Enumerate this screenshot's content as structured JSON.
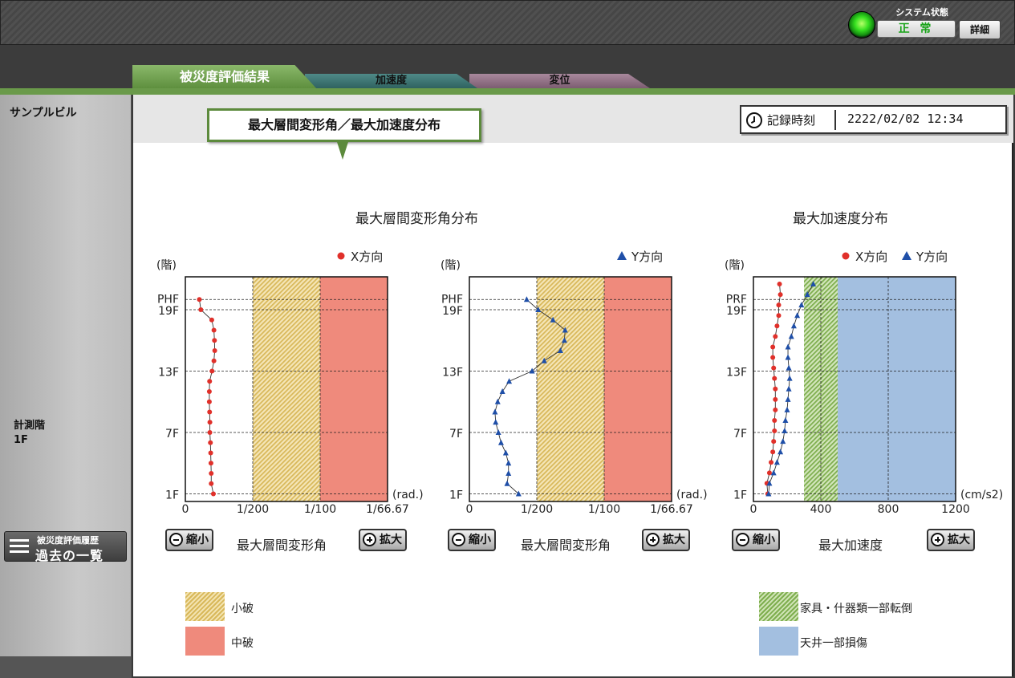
{
  "header": {
    "system_status_label": "システム状態",
    "system_status_value": "正 常",
    "status_led_color": "#36e020",
    "detail_button": "詳細"
  },
  "tabs": [
    {
      "label": "被災度評価結果",
      "active": true,
      "color": "#6a9a4a"
    },
    {
      "label": "加速度",
      "active": false,
      "color": "#3f7876"
    },
    {
      "label": "変位",
      "active": false,
      "color": "#8f7084"
    }
  ],
  "sidebar": {
    "building_name": "サンプルビル",
    "measurement_floor_label": "計測階",
    "measurement_floor_value": "1F",
    "history_button_sub": "被災度評価履歴",
    "history_button_main": "過去の一覧"
  },
  "main": {
    "section_title": "最大層間変形角／最大加速度分布",
    "record_time_label": "記録時刻",
    "record_time_value": "2222/02/02 12:34",
    "drift_title": "最大層間変形角分布",
    "accel_title": "最大加速度分布",
    "zoom_out_label": "縮小",
    "zoom_in_label": "拡大",
    "drift_axis_caption": "最大層間変形角",
    "accel_axis_caption": "最大加速度",
    "legend": [
      {
        "label": "小破",
        "style": "hatch-yellow"
      },
      {
        "label": "中破",
        "style": "fill-red"
      },
      {
        "label": "家具・什器類一部転倒",
        "style": "hatch-green"
      },
      {
        "label": "天井一部損傷",
        "style": "fill-blue"
      }
    ]
  },
  "chart_data": [
    {
      "type": "line",
      "title": "最大層間変形角分布",
      "xlabel": "最大層間変形角",
      "ylabel": "(階)",
      "x_unit": "(rad.)",
      "x_ticks": [
        "0",
        "1/200",
        "1/100",
        "1/66.67"
      ],
      "xlim": [
        0,
        0.015
      ],
      "y_ticks": [
        "1F",
        "7F",
        "13F",
        "19F",
        "PHF"
      ],
      "ylim": [
        0.5,
        21.5
      ],
      "legend": "top-right",
      "zones": [
        {
          "label": "小破",
          "from": 0.005,
          "to": 0.01,
          "color": "#d8b85a"
        },
        {
          "label": "中破",
          "from": 0.01,
          "to": 0.015,
          "color": "#ef8a7c"
        }
      ],
      "series": [
        {
          "name": "X方向",
          "color": "#e0302a",
          "marker": "circle",
          "floors": [
            1,
            2,
            3,
            4,
            5,
            6,
            7,
            8,
            9,
            10,
            11,
            12,
            13,
            14,
            15,
            16,
            17,
            18,
            19,
            20
          ],
          "values": [
            0.00208,
            0.00192,
            0.00192,
            0.0019,
            0.00188,
            0.00186,
            0.00182,
            0.00182,
            0.0018,
            0.00178,
            0.00178,
            0.0018,
            0.00198,
            0.00212,
            0.00218,
            0.00216,
            0.00212,
            0.00196,
            0.00115,
            0.00104
          ]
        },
        {
          "name": "Y方向",
          "color": "#1f4fa8",
          "marker": "triangle",
          "floors": [
            1,
            2,
            3,
            4,
            5,
            6,
            7,
            8,
            9,
            10,
            11,
            12,
            13,
            14,
            15,
            16,
            17,
            18,
            19,
            20
          ],
          "values": [
            0.00365,
            0.0028,
            0.0029,
            0.0029,
            0.0027,
            0.00235,
            0.00215,
            0.00195,
            0.0019,
            0.0021,
            0.00245,
            0.00295,
            0.00465,
            0.00555,
            0.00675,
            0.00705,
            0.0071,
            0.0062,
            0.0051,
            0.00425
          ]
        }
      ]
    },
    {
      "type": "line",
      "title": "最大加速度分布",
      "xlabel": "最大加速度",
      "ylabel": "(階)",
      "x_unit": "(cm/s2)",
      "x_ticks": [
        "0",
        "400",
        "800",
        "1200"
      ],
      "xlim": [
        0,
        1200
      ],
      "y_ticks": [
        "1F",
        "7F",
        "13F",
        "19F",
        "PRF"
      ],
      "ylim": [
        0.5,
        21.5
      ],
      "legend": "top-right",
      "zones": [
        {
          "label": "家具・什器類一部転倒",
          "from": 300,
          "to": 500,
          "color": "#7eae4e"
        },
        {
          "label": "天井一部損傷",
          "from": 500,
          "to": 1200,
          "color": "#a3bfe0"
        }
      ],
      "series": [
        {
          "name": "X方向",
          "color": "#e0302a",
          "marker": "circle",
          "floors": [
            1,
            2,
            3,
            4,
            5,
            6,
            7,
            8,
            9,
            10,
            11,
            12,
            13,
            14,
            15,
            16,
            17,
            18,
            19,
            20,
            21
          ],
          "values": [
            85,
            80,
            95,
            105,
            115,
            120,
            125,
            125,
            130,
            130,
            130,
            125,
            120,
            115,
            115,
            130,
            140,
            150,
            150,
            160,
            155
          ]
        },
        {
          "name": "Y方向",
          "color": "#1f4fa8",
          "marker": "triangle",
          "floors": [
            1,
            2,
            3,
            4,
            5,
            6,
            7,
            8,
            9,
            10,
            11,
            12,
            13,
            14,
            15,
            16,
            17,
            18,
            19,
            20,
            21
          ],
          "values": [
            90,
            95,
            120,
            140,
            160,
            175,
            185,
            190,
            200,
            205,
            210,
            215,
            210,
            205,
            205,
            225,
            240,
            260,
            285,
            320,
            355
          ]
        }
      ]
    }
  ]
}
